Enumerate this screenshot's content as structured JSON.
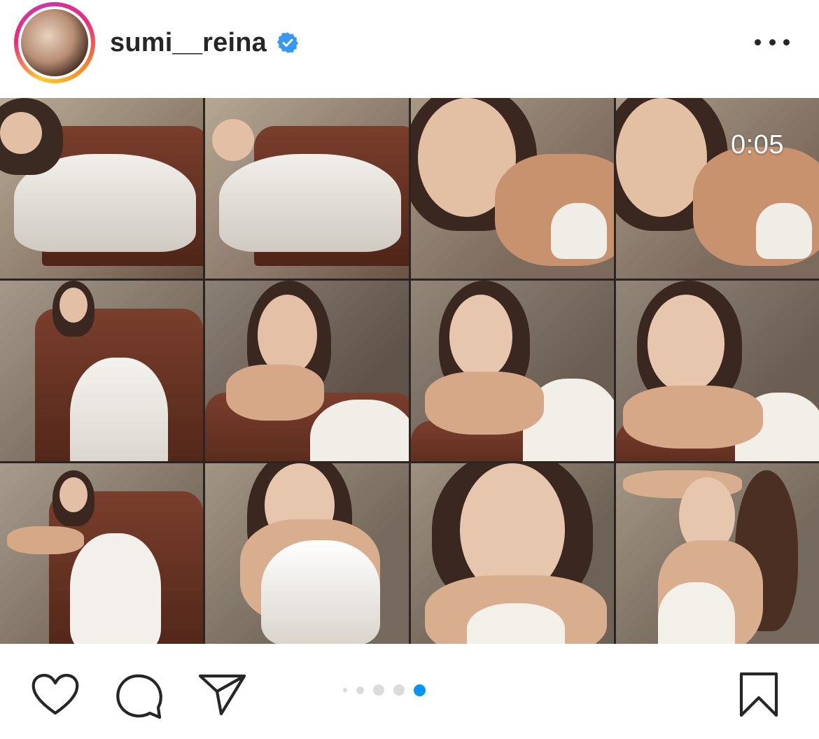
{
  "post": {
    "username": "sumi__reina",
    "verified": true,
    "video_timer": "0:05"
  },
  "carousel": {
    "count": 5,
    "active_index": 4
  },
  "icons": {
    "verified": "verified-badge-icon",
    "more": "more-options-icon",
    "like": "heart-icon",
    "comment": "comment-icon",
    "share": "share-icon",
    "save": "bookmark-icon"
  },
  "colors": {
    "text": "#262626",
    "verified_blue": "#3897f0",
    "active_dot": "#0095f6",
    "inactive_dot": "#dbdbdb"
  }
}
